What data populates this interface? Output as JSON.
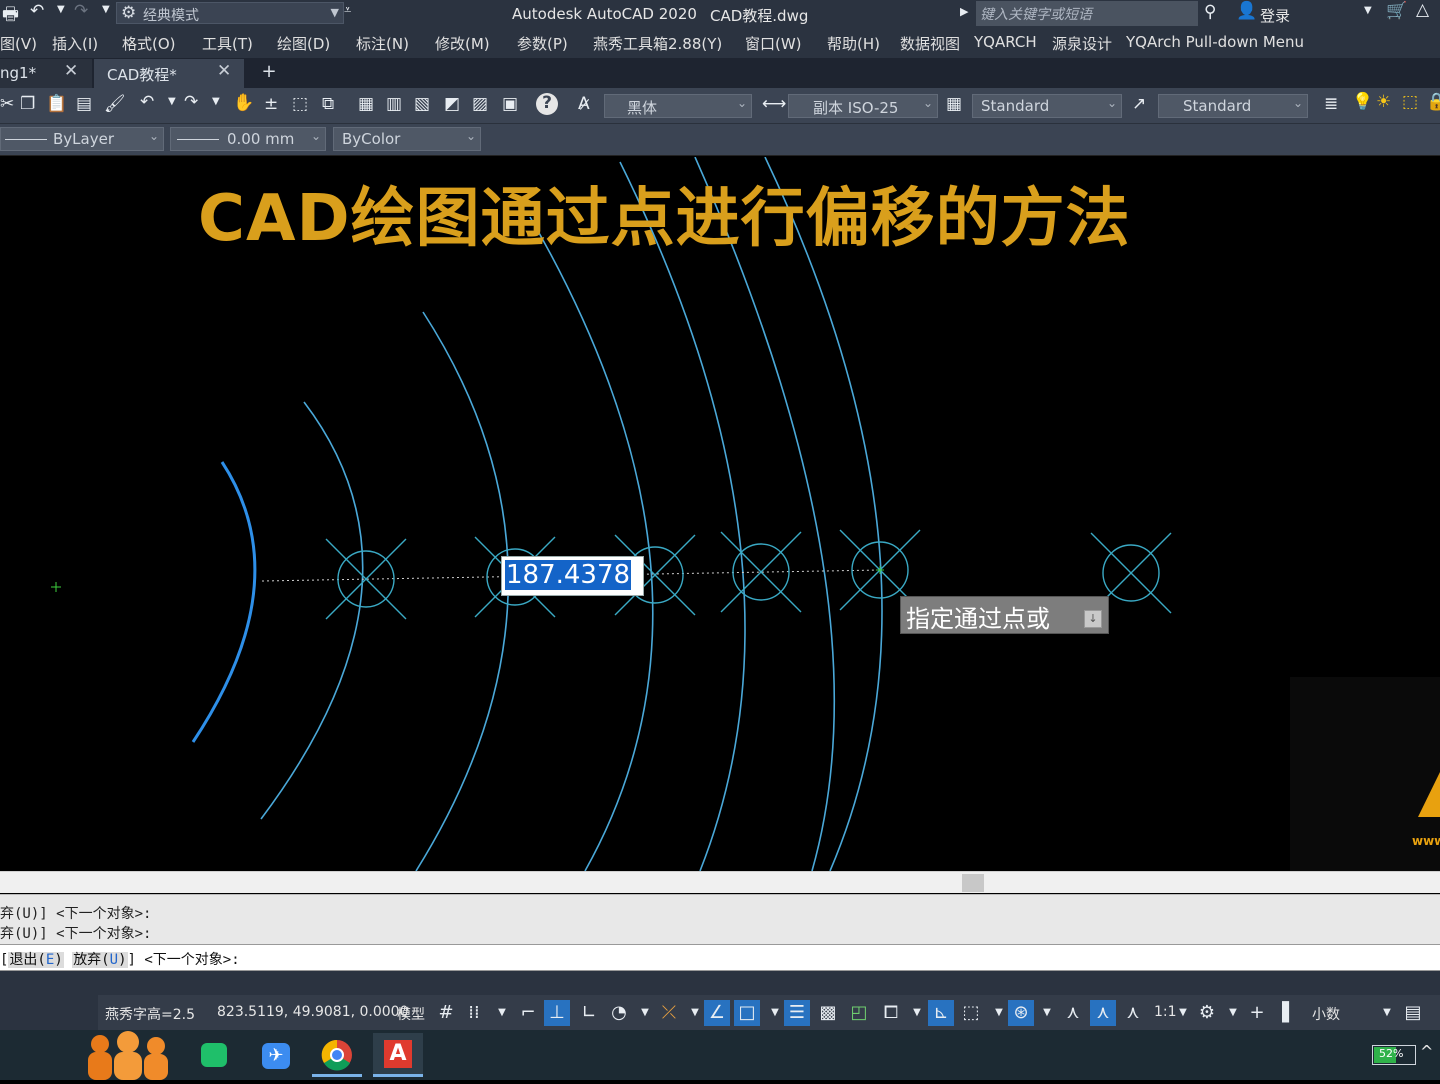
{
  "titlebar": {
    "workspace": "经典模式",
    "app_title": "Autodesk AutoCAD 2020",
    "doc_title": "CAD教程.dwg",
    "search_placeholder": "键入关键字或短语",
    "login": "登录"
  },
  "menu": [
    "图(V)",
    "插入(I)",
    "格式(O)",
    "工具(T)",
    "绘图(D)",
    "标注(N)",
    "修改(M)",
    "参数(P)",
    "燕秀工具箱2.88(Y)",
    "窗口(W)",
    "帮助(H)",
    "数据视图",
    "YQARCH",
    "源泉设计",
    "YQArch Pull-down Menu"
  ],
  "tabs": [
    {
      "label": "ng1*",
      "active": false
    },
    {
      "label": "CAD教程*",
      "active": true
    }
  ],
  "toolbar": {
    "text_style_font": "黑体",
    "dim_style": "副本 ISO-25",
    "table_style": "Standard",
    "mleader_style": "Standard",
    "linetype": "ByLayer",
    "lineweight": "0.00 mm",
    "plot_style": "ByColor"
  },
  "canvas": {
    "title": "CAD绘图通过点进行偏移的方法",
    "dynamic_input_value": "187.4378",
    "tooltip": "指定通过点或",
    "colors": {
      "title": "#d99f1c",
      "arc": "#4aa8d8",
      "selected_arc": "#2e8fe8",
      "point": "#3aa9c4",
      "background": "#000000"
    }
  },
  "command": {
    "history": [
      "弃(U)] <下一个对象>:",
      "弃(U)] <下一个对象>:"
    ],
    "current_prefix": "[",
    "opt_exit": "退出(",
    "opt_exit_key": "E",
    "opt_exit_end": ")",
    "opt_undo": "放弃(",
    "opt_undo_key": "U",
    "opt_undo_end": ")",
    "current_suffix": "] <下一个对象>:"
  },
  "status": {
    "text_height": "燕秀字高=2.5",
    "coordinates": "823.5119, 49.9081, 0.0000",
    "space": "模型",
    "scale": "1:1",
    "units": "小数"
  },
  "taskbar": {
    "battery": "52%"
  }
}
